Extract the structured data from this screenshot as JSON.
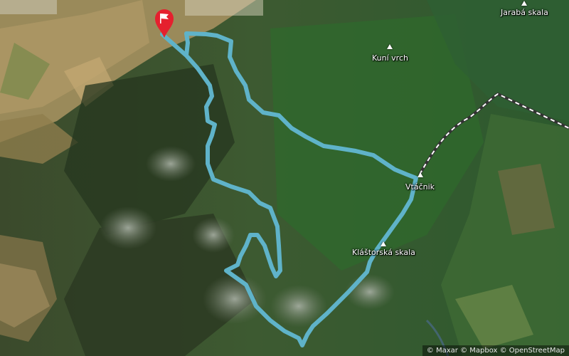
{
  "map": {
    "labels": {
      "jaraba_skala": "Jarabá skala",
      "kuni_vrch": "Kuní vrch",
      "vtacnik": "Vtáčnik",
      "klastorska_skala": "Kláštorská skala"
    },
    "route_color": "#5fb3c9",
    "marker_color": "#e5202e",
    "marker_icon": "flag-icon"
  },
  "attribution": {
    "maxar": "© Maxar",
    "mapbox": "© Mapbox",
    "osm": "© OpenStreetMap"
  }
}
